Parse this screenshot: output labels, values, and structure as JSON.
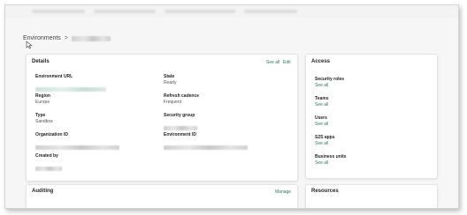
{
  "breadcrumb": {
    "root": "Environments",
    "separator": ">"
  },
  "details": {
    "title": "Details",
    "see_all": "See all",
    "edit": "Edit",
    "fields": [
      {
        "label": "Environment URL",
        "value": ""
      },
      {
        "label": "State",
        "value": "Ready"
      },
      {
        "label": "Region",
        "value": "Europe"
      },
      {
        "label": "Refresh cadence",
        "value": "Frequent"
      },
      {
        "label": "Type",
        "value": "Sandbox"
      },
      {
        "label": "Security group",
        "value": ""
      },
      {
        "label": "Organization ID",
        "value": ""
      },
      {
        "label": "Environment ID",
        "value": ""
      },
      {
        "label": "Created by",
        "value": ""
      }
    ]
  },
  "access": {
    "title": "Access",
    "items": [
      {
        "label": "Security roles",
        "link": "See all"
      },
      {
        "label": "Teams",
        "link": "See all"
      },
      {
        "label": "Users",
        "link": "See all"
      },
      {
        "label": "S2S apps",
        "link": "See all"
      },
      {
        "label": "Business units",
        "link": "See all"
      }
    ]
  },
  "auditing": {
    "title": "Auditing",
    "manage": "Manage"
  },
  "resources": {
    "title": "Resources"
  },
  "colors": {
    "link": "#2a7a62",
    "background": "#f6f6f6",
    "card": "#ffffff"
  }
}
